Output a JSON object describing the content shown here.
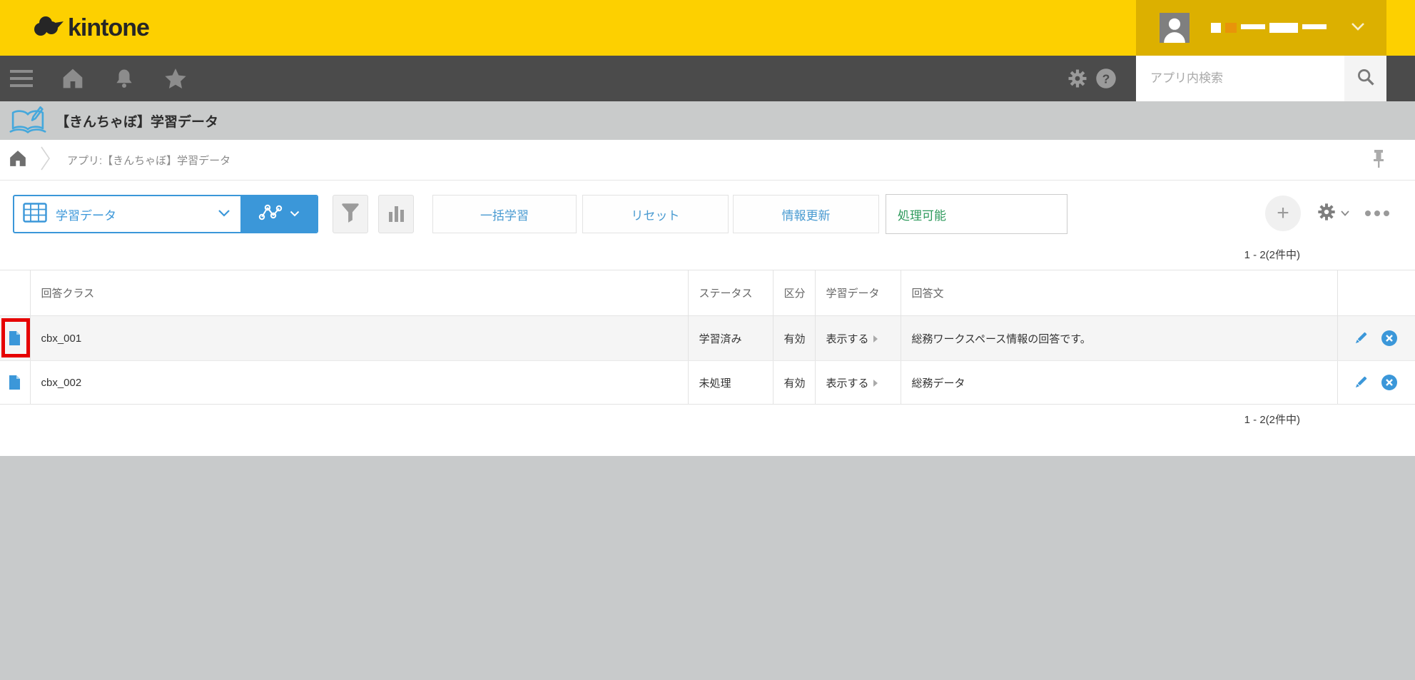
{
  "colors": {
    "brand_yellow": "#FDD000",
    "user_area_gold": "#DCB000",
    "nav_gray": "#4B4B4B",
    "accent_blue": "#3B97D9",
    "button_text_blue": "#4A9BD1",
    "status_green": "#2E9A5C",
    "highlight_red": "#E60000",
    "title_bar_gray": "#C9CBCB",
    "page_bg_gray": "#C8CACB",
    "row_stripe_gray": "#F5F5F5"
  },
  "topbar": {
    "logo_text": "kintone"
  },
  "navbar": {
    "search_placeholder": "アプリ内検索"
  },
  "app_bar": {
    "title": "【きんちゃぼ】学習データ"
  },
  "breadcrumb": {
    "text": "アプリ:【きんちゃぼ】学習データ"
  },
  "toolbar": {
    "view_selector": {
      "label": "学習データ"
    },
    "buttons": [
      {
        "label": "一括学習"
      },
      {
        "label": "リセット"
      },
      {
        "label": "情報更新"
      }
    ],
    "status_filter": {
      "label": "処理可能"
    }
  },
  "pagination": {
    "label": "1 - 2(2件中)"
  },
  "table": {
    "headers": [
      "回答クラス",
      "ステータス",
      "区分",
      "学習データ",
      "回答文"
    ],
    "rows": [
      {
        "class_name": "cbx_001",
        "status": "学習済み",
        "category": "有効",
        "learning_data": "表示する",
        "answer": "総務ワークスペース情報の回答です。",
        "highlighted": "true"
      },
      {
        "class_name": "cbx_002",
        "status": "未処理",
        "category": "有効",
        "learning_data": "表示する",
        "answer": "総務データ",
        "highlighted": "false"
      }
    ]
  }
}
